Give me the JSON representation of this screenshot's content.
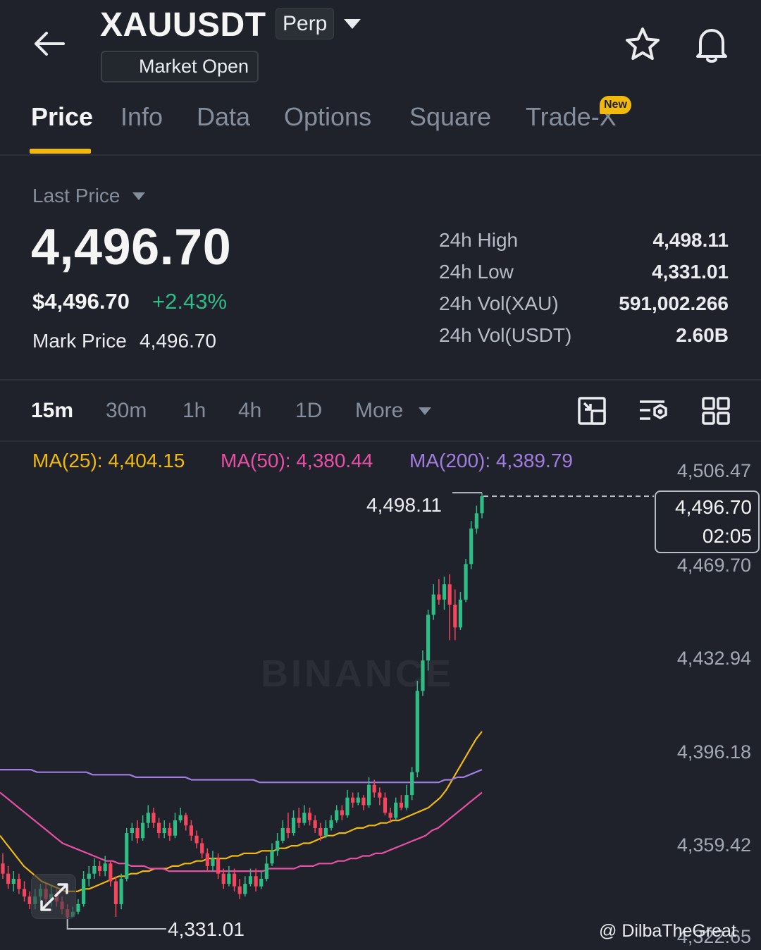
{
  "header": {
    "symbol": "XAUUSDT",
    "contract_type": "Perp",
    "market_status": "Market Open"
  },
  "tabs": [
    {
      "label": "Price",
      "active": true
    },
    {
      "label": "Info"
    },
    {
      "label": "Data"
    },
    {
      "label": "Options"
    },
    {
      "label": "Square"
    },
    {
      "label": "Trade-X",
      "badge": "New"
    }
  ],
  "price": {
    "selector_label": "Last Price",
    "last": "4,496.70",
    "usd": "$4,496.70",
    "change_pct": "+2.43%",
    "mark_label": "Mark Price",
    "mark_value": "4,496.70"
  },
  "stats": [
    {
      "label": "24h High",
      "value": "4,498.11"
    },
    {
      "label": "24h Low",
      "value": "4,331.01"
    },
    {
      "label": "24h Vol(XAU)",
      "value": "591,002.266"
    },
    {
      "label": "24h Vol(USDT)",
      "value": "2.60B"
    }
  ],
  "intervals": [
    {
      "label": "15m",
      "active": true
    },
    {
      "label": "30m"
    },
    {
      "label": "1h"
    },
    {
      "label": "4h"
    },
    {
      "label": "1D"
    },
    {
      "label": "More"
    }
  ],
  "ma_legend": [
    {
      "text": "MA(25): 4,404.15",
      "color": "#f0b90b"
    },
    {
      "text": "MA(50): 4,380.44",
      "color": "#e84fa6"
    },
    {
      "text": "MA(200): 4,389.79",
      "color": "#a27de0"
    }
  ],
  "chart": {
    "axis_labels": [
      "4,506.47",
      "4,469.70",
      "4,432.94",
      "4,396.18",
      "4,359.42",
      "4,322.65"
    ],
    "current_price": "4,496.70",
    "countdown": "02:05",
    "high_marker": "4,498.11",
    "low_marker": "4,331.01",
    "watermark": "BINANCE",
    "credit": "@ DilbaTheGreat"
  },
  "colors": {
    "up": "#2ebd85",
    "down": "#f6465d",
    "accent": "#f0b90b"
  },
  "chart_data": {
    "type": "candlestick",
    "interval": "15m",
    "y_ticks": [
      4506.47,
      4469.7,
      4432.94,
      4396.18,
      4359.42,
      4322.65
    ],
    "ylim": [
      4322.65,
      4506.47
    ],
    "current_price": 4496.7,
    "high": 4498.11,
    "low": 4331.01,
    "candles": [
      [
        4352,
        4348,
        4356,
        4346
      ],
      [
        4348,
        4344,
        4351,
        4342
      ],
      [
        4344,
        4346,
        4349,
        4341
      ],
      [
        4346,
        4342,
        4348,
        4340
      ],
      [
        4342,
        4339,
        4345,
        4337
      ],
      [
        4339,
        4336,
        4341,
        4334
      ],
      [
        4336,
        4339,
        4342,
        4334
      ],
      [
        4339,
        4342,
        4344,
        4337
      ],
      [
        4342,
        4338,
        4344,
        4336
      ],
      [
        4338,
        4340,
        4343,
        4335
      ],
      [
        4340,
        4337,
        4342,
        4335
      ],
      [
        4337,
        4334,
        4339,
        4332
      ],
      [
        4334,
        4331,
        4336,
        4330
      ],
      [
        4331,
        4333,
        4335,
        4331
      ],
      [
        4333,
        4336,
        4338,
        4332
      ],
      [
        4336,
        4346,
        4349,
        4335
      ],
      [
        4346,
        4348,
        4351,
        4343
      ],
      [
        4348,
        4351,
        4354,
        4346
      ],
      [
        4351,
        4349,
        4353,
        4347
      ],
      [
        4349,
        4352,
        4355,
        4347
      ],
      [
        4352,
        4345,
        4353,
        4343
      ],
      [
        4345,
        4336,
        4347,
        4331
      ],
      [
        4336,
        4346,
        4348,
        4334
      ],
      [
        4346,
        4364,
        4366,
        4345
      ],
      [
        4364,
        4366,
        4368,
        4361
      ],
      [
        4366,
        4362,
        4369,
        4360
      ],
      [
        4362,
        4368,
        4371,
        4361
      ],
      [
        4368,
        4372,
        4375,
        4366
      ],
      [
        4372,
        4368,
        4374,
        4366
      ],
      [
        4368,
        4364,
        4370,
        4362
      ],
      [
        4364,
        4366,
        4369,
        4362
      ],
      [
        4366,
        4363,
        4368,
        4361
      ],
      [
        4363,
        4369,
        4372,
        4362
      ],
      [
        4369,
        4371,
        4374,
        4368
      ],
      [
        4371,
        4367,
        4372,
        4365
      ],
      [
        4367,
        4363,
        4369,
        4361
      ],
      [
        4363,
        4360,
        4365,
        4358
      ],
      [
        4360,
        4356,
        4362,
        4354
      ],
      [
        4356,
        4351,
        4358,
        4349
      ],
      [
        4351,
        4354,
        4357,
        4349
      ],
      [
        4354,
        4348,
        4356,
        4346
      ],
      [
        4348,
        4344,
        4350,
        4342
      ],
      [
        4344,
        4348,
        4351,
        4343
      ],
      [
        4348,
        4343,
        4350,
        4341
      ],
      [
        4343,
        4340,
        4346,
        4338
      ],
      [
        4340,
        4344,
        4347,
        4339
      ],
      [
        4344,
        4347,
        4350,
        4343
      ],
      [
        4347,
        4343,
        4350,
        4341
      ],
      [
        4343,
        4346,
        4349,
        4342
      ],
      [
        4346,
        4352,
        4355,
        4345
      ],
      [
        4352,
        4357,
        4360,
        4351
      ],
      [
        4357,
        4361,
        4364,
        4355
      ],
      [
        4361,
        4366,
        4369,
        4360
      ],
      [
        4366,
        4364,
        4372,
        4362
      ],
      [
        4364,
        4370,
        4373,
        4363
      ],
      [
        4370,
        4368,
        4374,
        4366
      ],
      [
        4368,
        4372,
        4375,
        4367
      ],
      [
        4372,
        4369,
        4374,
        4367
      ],
      [
        4369,
        4366,
        4371,
        4364
      ],
      [
        4366,
        4363,
        4368,
        4361
      ],
      [
        4363,
        4366,
        4369,
        4362
      ],
      [
        4366,
        4369,
        4371,
        4365
      ],
      [
        4369,
        4373,
        4375,
        4368
      ],
      [
        4373,
        4371,
        4375,
        4369
      ],
      [
        4371,
        4378,
        4381,
        4370
      ],
      [
        4378,
        4376,
        4380,
        4374
      ],
      [
        4376,
        4378,
        4380,
        4375
      ],
      [
        4378,
        4375,
        4379,
        4373
      ],
      [
        4375,
        4383,
        4386,
        4374
      ],
      [
        4383,
        4380,
        4385,
        4378
      ],
      [
        4380,
        4378,
        4382,
        4375
      ],
      [
        4378,
        4372,
        4380,
        4371
      ],
      [
        4372,
        4370,
        4374,
        4368
      ],
      [
        4370,
        4376,
        4378,
        4369
      ],
      [
        4376,
        4374,
        4379,
        4373
      ],
      [
        4374,
        4379,
        4383,
        4373
      ],
      [
        4379,
        4388,
        4390,
        4377
      ],
      [
        4388,
        4420,
        4424,
        4386
      ],
      [
        4420,
        4432,
        4436,
        4418
      ],
      [
        4432,
        4450,
        4452,
        4428
      ],
      [
        4450,
        4458,
        4462,
        4448
      ],
      [
        4458,
        4456,
        4464,
        4454
      ],
      [
        4456,
        4462,
        4465,
        4452
      ],
      [
        4462,
        4454,
        4466,
        4440
      ],
      [
        4454,
        4445,
        4460,
        4440
      ],
      [
        4445,
        4456,
        4459,
        4444
      ],
      [
        4456,
        4470,
        4472,
        4455
      ],
      [
        4470,
        4484,
        4487,
        4468
      ],
      [
        4484,
        4490,
        4493,
        4482
      ],
      [
        4490,
        4496.7,
        4498.11,
        4488
      ]
    ],
    "ma_series": [
      {
        "name": "MA(25)",
        "color": "#f0b90b",
        "values": [
          4363,
          4360,
          4357,
          4354,
          4351,
          4349,
          4347,
          4345,
          4344,
          4343,
          4342,
          4341,
          4341,
          4341,
          4342,
          4342,
          4343,
          4344,
          4345,
          4346,
          4347,
          4347,
          4348,
          4348,
          4349,
          4349,
          4350,
          4350,
          4350,
          4351,
          4351,
          4352,
          4352,
          4353,
          4353,
          4354,
          4354,
          4354,
          4354,
          4355,
          4355,
          4356,
          4356,
          4356,
          4357,
          4357,
          4357,
          4358,
          4358,
          4359,
          4359,
          4360,
          4360,
          4361,
          4362,
          4363,
          4363,
          4364,
          4364,
          4365,
          4366,
          4366,
          4367,
          4367,
          4368,
          4368,
          4369,
          4369,
          4370,
          4371,
          4372,
          4373,
          4374,
          4376,
          4378,
          4381,
          4385,
          4389,
          4393,
          4397,
          4401,
          4404
        ]
      },
      {
        "name": "MA(50)",
        "color": "#e84fa6",
        "values": [
          4380,
          4378,
          4376,
          4374,
          4372,
          4370,
          4368,
          4366,
          4364,
          4362,
          4360,
          4359,
          4358,
          4357,
          4356,
          4355,
          4354,
          4353,
          4353,
          4352,
          4352,
          4351,
          4351,
          4351,
          4350,
          4350,
          4350,
          4349,
          4349,
          4349,
          4349,
          4349,
          4349,
          4349,
          4349,
          4349,
          4349,
          4349,
          4349,
          4349,
          4349,
          4349,
          4349,
          4350,
          4350,
          4350,
          4350,
          4350,
          4351,
          4351,
          4351,
          4352,
          4352,
          4352,
          4353,
          4353,
          4354,
          4354,
          4355,
          4355,
          4356,
          4356,
          4357,
          4358,
          4359,
          4360,
          4361,
          4362,
          4363,
          4365,
          4366,
          4368,
          4370,
          4372,
          4374,
          4376,
          4378,
          4380
        ]
      },
      {
        "name": "MA(200)",
        "color": "#a27de0",
        "values": [
          4389,
          4389,
          4389,
          4389,
          4389,
          4389,
          4388,
          4388,
          4388,
          4388,
          4388,
          4388,
          4388,
          4388,
          4388,
          4387,
          4387,
          4387,
          4387,
          4387,
          4387,
          4387,
          4386,
          4386,
          4386,
          4386,
          4386,
          4386,
          4386,
          4386,
          4386,
          4385,
          4385,
          4385,
          4385,
          4385,
          4385,
          4385,
          4385,
          4385,
          4385,
          4385,
          4384,
          4384,
          4384,
          4384,
          4384,
          4384,
          4384,
          4384,
          4384,
          4384,
          4384,
          4384,
          4384,
          4384,
          4384,
          4384,
          4384,
          4384,
          4384,
          4384,
          4384,
          4384,
          4384,
          4384,
          4384,
          4384,
          4384,
          4384,
          4384,
          4384,
          4385,
          4385,
          4386,
          4386,
          4387,
          4388,
          4389
        ]
      }
    ]
  }
}
